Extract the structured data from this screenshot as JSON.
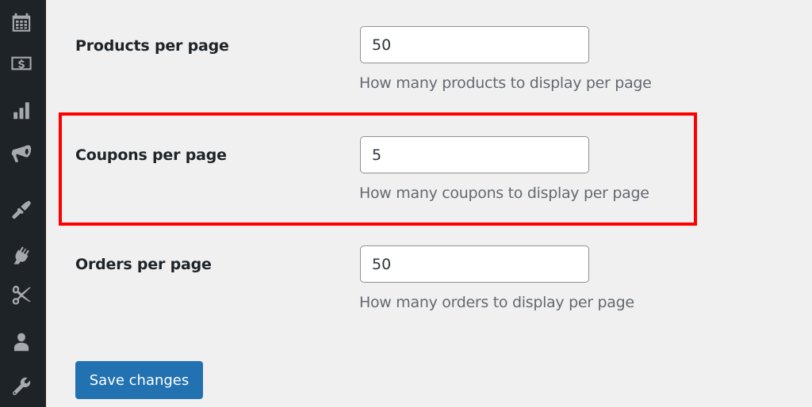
{
  "sidebar": {
    "icons": [
      {
        "name": "calendar-icon"
      },
      {
        "name": "dollar-icon"
      },
      {
        "name": "analytics-bar-icon"
      },
      {
        "name": "megaphone-icon"
      },
      {
        "name": "paintbrush-icon"
      },
      {
        "name": "plugin-icon"
      },
      {
        "name": "scissors-icon"
      },
      {
        "name": "user-icon"
      },
      {
        "name": "wrench-icon"
      }
    ]
  },
  "settings": {
    "rows": [
      {
        "label": "Products per page",
        "value": "50",
        "help": "How many products to display per page"
      },
      {
        "label": "Coupons per page",
        "value": "5",
        "help": "How many coupons to display per page",
        "highlighted": true
      },
      {
        "label": "Orders per page",
        "value": "50",
        "help": "How many orders to display per page"
      }
    ]
  },
  "actions": {
    "save_label": "Save changes"
  },
  "colors": {
    "sidebar_bg": "#1d2327",
    "icon": "#a7aaad",
    "primary_button": "#2271b1",
    "highlight": "#ff0000"
  }
}
